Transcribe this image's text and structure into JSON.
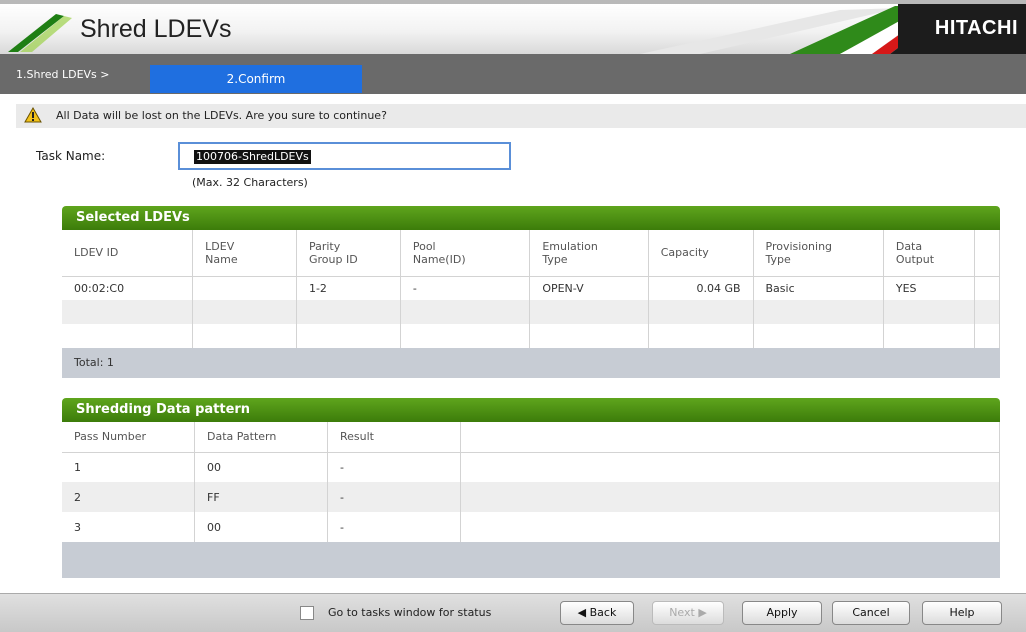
{
  "window": {
    "title": "Shred LDEVs",
    "brand": "HITACHI"
  },
  "wizard": {
    "step1": "1.Shred LDEVs  >",
    "step2": "2.Confirm"
  },
  "warning": {
    "icon": "warning-icon",
    "text": "All Data will be lost on the LDEVs. Are you sure to continue?"
  },
  "task": {
    "label": "Task Name:",
    "value": "100706-ShredLDEVs",
    "hint": "(Max. 32 Characters)"
  },
  "selected": {
    "title": "Selected LDEVs",
    "columns": [
      [
        "LDEV ID",
        ""
      ],
      [
        "LDEV",
        "Name"
      ],
      [
        "Parity",
        "Group ID"
      ],
      [
        "Pool",
        "Name(ID)"
      ],
      [
        "Emulation",
        "Type"
      ],
      [
        "Capacity",
        ""
      ],
      [
        "Provisioning",
        "Type"
      ],
      [
        "Data",
        "Output"
      ]
    ],
    "rows": [
      [
        "00:02:C0",
        "",
        "1-2",
        "-",
        "OPEN-V",
        "0.04 GB",
        "Basic",
        "YES"
      ]
    ],
    "total": "Total:  1"
  },
  "shredding": {
    "title": "Shredding Data pattern",
    "columns": [
      "Pass Number",
      "Data Pattern",
      "Result"
    ],
    "rows": [
      [
        "1",
        "00",
        "-"
      ],
      [
        "2",
        "FF",
        "-"
      ],
      [
        "3",
        "00",
        "-"
      ]
    ]
  },
  "footer": {
    "checkbox_label": "Go to tasks window for status",
    "back": "◀ Back",
    "next": "Next ▶",
    "apply": "Apply",
    "cancel": "Cancel",
    "help": "Help"
  },
  "colors": {
    "header_green": "#4a8f14",
    "wizard_blue": "#1f6fe0",
    "wizard_bar": "#6a6a6a",
    "total_bar": "#c7ccd4"
  }
}
